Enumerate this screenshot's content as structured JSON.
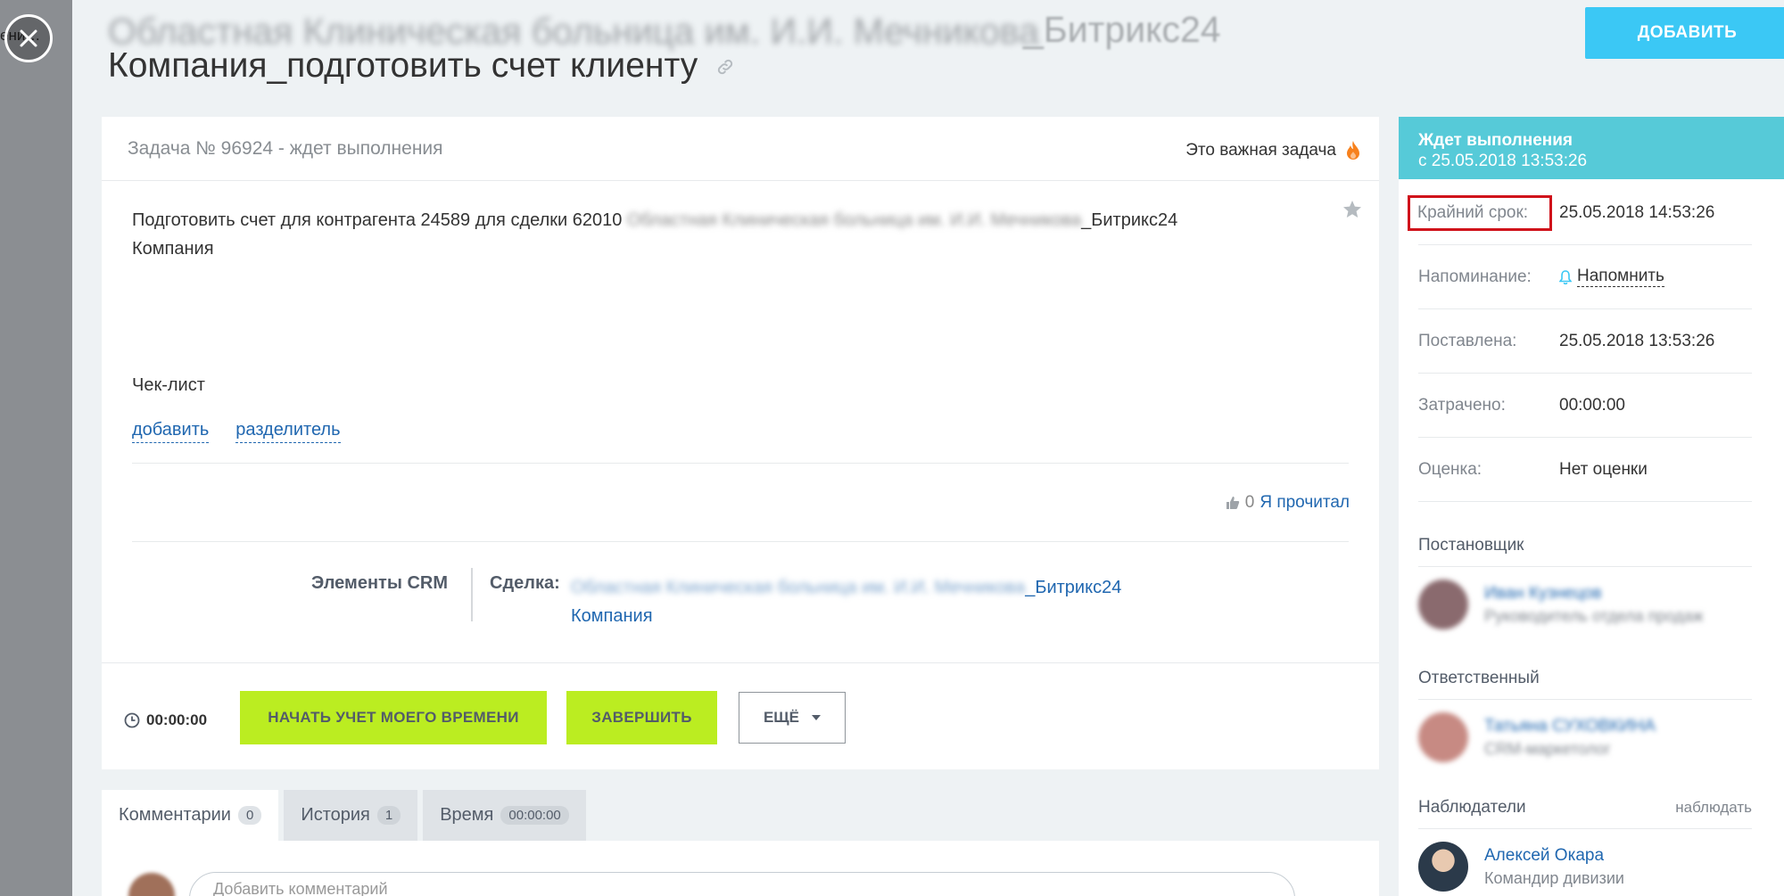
{
  "overlay": {
    "cut_text": "ени…",
    "close_icon": "close-icon"
  },
  "header": {
    "blurred_title": "Областная Клиническая больница им. И.И. Мечникова",
    "blurred_title_tail": "_Битрикс24",
    "task_title": "Компания_подготовить счет клиенту",
    "add_button": "ДОБАВИТЬ"
  },
  "task": {
    "number_status": "Задача № 96924 - ждет выполнения",
    "important": "Это важная задача",
    "description_line1": "Подготовить счет для контрагента 24589 для сделки 62010",
    "description_blur": "Областная Клиническая больница им. И.И. Мечникова",
    "description_tail": "_Битрикс24",
    "description_line2": "Компания",
    "checklist_title": "Чек-лист",
    "checklist_add": "добавить",
    "checklist_separator": "разделитель",
    "likes_count": "0",
    "read_link": "Я прочитал",
    "crm_label": "Элементы CRM",
    "crm_deal_label": "Сделка:",
    "crm_deal_blur": "Областная Клиническая больница им. И.И. Мечникова",
    "crm_deal_tail": "_Битрикс24",
    "crm_deal_line2": "Компания",
    "timer": "00:00:00",
    "btn_start": "НАЧАТЬ УЧЕТ МОЕГО ВРЕМЕНИ",
    "btn_finish": "ЗАВЕРШИТЬ",
    "btn_more": "ЕЩЁ"
  },
  "tabs": [
    {
      "label": "Комментарии",
      "badge": "0"
    },
    {
      "label": "История",
      "badge": "1"
    },
    {
      "label": "Время",
      "badge": "00:00:00"
    }
  ],
  "comment": {
    "placeholder": "Добавить комментарий"
  },
  "sidebar": {
    "status_title": "Ждет выполнения",
    "status_since": "с 25.05.2018 13:53:26",
    "deadline_label": "Крайний срок:",
    "deadline_value": "25.05.2018 14:53:26",
    "reminder_label": "Напоминание:",
    "reminder_value": "Напомнить",
    "created_label": "Поставлена:",
    "created_value": "25.05.2018 13:53:26",
    "spent_label": "Затрачено:",
    "spent_value": "00:00:00",
    "rating_label": "Оценка:",
    "rating_value": "Нет оценки",
    "creator_heading": "Постановщик",
    "creator_name": "Иван Кузнецов",
    "creator_role": "Руководитель отдела продаж",
    "responsible_heading": "Ответственный",
    "responsible_name": "Татьяна СУХОВКИНА",
    "responsible_role": "CRM-маркетолог",
    "watchers_heading": "Наблюдатели",
    "watch_link": "наблюдать",
    "watcher_name": "Алексей Окара",
    "watcher_role": "Командир дивизии"
  },
  "colors": {
    "accent": "#3bc8f5",
    "status": "#56cad8",
    "green": "#bbed21",
    "link": "#2067b0",
    "highlight": "#d0121b"
  }
}
